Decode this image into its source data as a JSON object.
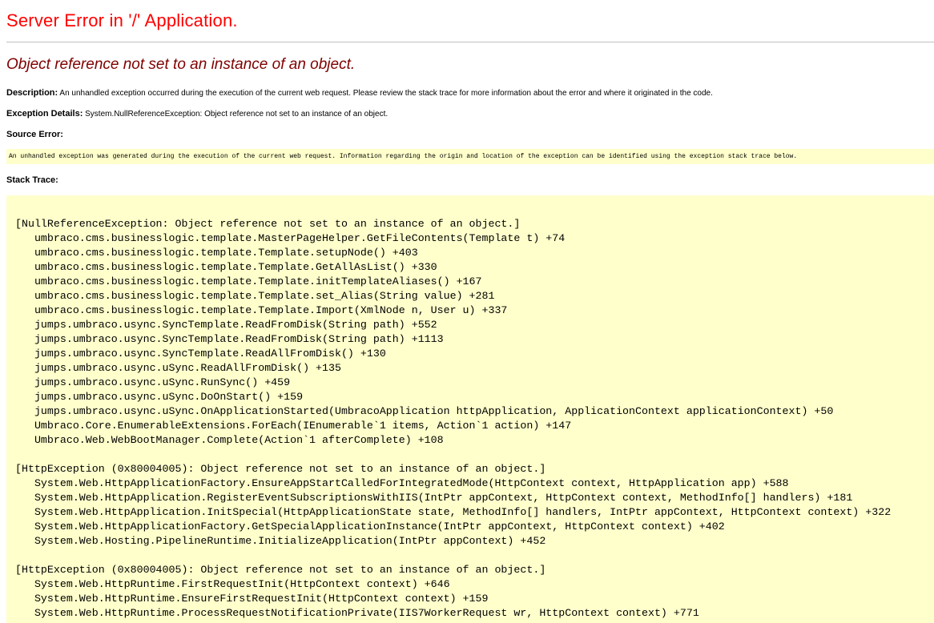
{
  "header": {
    "title": "Server Error in '/' Application.",
    "subtitle": "Object reference not set to an instance of an object."
  },
  "description": {
    "label": "Description:",
    "text": " An unhandled exception occurred during the execution of the current web request. Please review the stack trace for more information about the error and where it originated in the code."
  },
  "exception_details": {
    "label": "Exception Details:",
    "text": " System.NullReferenceException: Object reference not set to an instance of an object."
  },
  "source_error": {
    "label": "Source Error:",
    "text": "An unhandled exception was generated during the execution of the current web request. Information regarding the origin and location of the exception can be identified using the exception stack trace below."
  },
  "stack_trace": {
    "label": "Stack Trace:",
    "lines": [
      "[NullReferenceException: Object reference not set to an instance of an object.]",
      "   umbraco.cms.businesslogic.template.MasterPageHelper.GetFileContents(Template t) +74",
      "   umbraco.cms.businesslogic.template.Template.setupNode() +403",
      "   umbraco.cms.businesslogic.template.Template.GetAllAsList() +330",
      "   umbraco.cms.businesslogic.template.Template.initTemplateAliases() +167",
      "   umbraco.cms.businesslogic.template.Template.set_Alias(String value) +281",
      "   umbraco.cms.businesslogic.template.Template.Import(XmlNode n, User u) +337",
      "   jumps.umbraco.usync.SyncTemplate.ReadFromDisk(String path) +552",
      "   jumps.umbraco.usync.SyncTemplate.ReadFromDisk(String path) +1113",
      "   jumps.umbraco.usync.SyncTemplate.ReadAllFromDisk() +130",
      "   jumps.umbraco.usync.uSync.ReadAllFromDisk() +135",
      "   jumps.umbraco.usync.uSync.RunSync() +459",
      "   jumps.umbraco.usync.uSync.DoOnStart() +159",
      "   jumps.umbraco.usync.uSync.OnApplicationStarted(UmbracoApplication httpApplication, ApplicationContext applicationContext) +50",
      "   Umbraco.Core.EnumerableExtensions.ForEach(IEnumerable`1 items, Action`1 action) +147",
      "   Umbraco.Web.WebBootManager.Complete(Action`1 afterComplete) +108",
      "",
      "[HttpException (0x80004005): Object reference not set to an instance of an object.]",
      "   System.Web.HttpApplicationFactory.EnsureAppStartCalledForIntegratedMode(HttpContext context, HttpApplication app) +588",
      "   System.Web.HttpApplication.RegisterEventSubscriptionsWithIIS(IntPtr appContext, HttpContext context, MethodInfo[] handlers) +181",
      "   System.Web.HttpApplication.InitSpecial(HttpApplicationState state, MethodInfo[] handlers, IntPtr appContext, HttpContext context) +322",
      "   System.Web.HttpApplicationFactory.GetSpecialApplicationInstance(IntPtr appContext, HttpContext context) +402",
      "   System.Web.Hosting.PipelineRuntime.InitializeApplication(IntPtr appContext) +452",
      "",
      "[HttpException (0x80004005): Object reference not set to an instance of an object.]",
      "   System.Web.HttpRuntime.FirstRequestInit(HttpContext context) +646",
      "   System.Web.HttpRuntime.EnsureFirstRequestInit(HttpContext context) +159",
      "   System.Web.HttpRuntime.ProcessRequestNotificationPrivate(IIS7WorkerRequest wr, HttpContext context) +771"
    ]
  },
  "colors": {
    "title": "#ff0000",
    "subtitle": "#800000",
    "code_background": "#ffffcc"
  }
}
